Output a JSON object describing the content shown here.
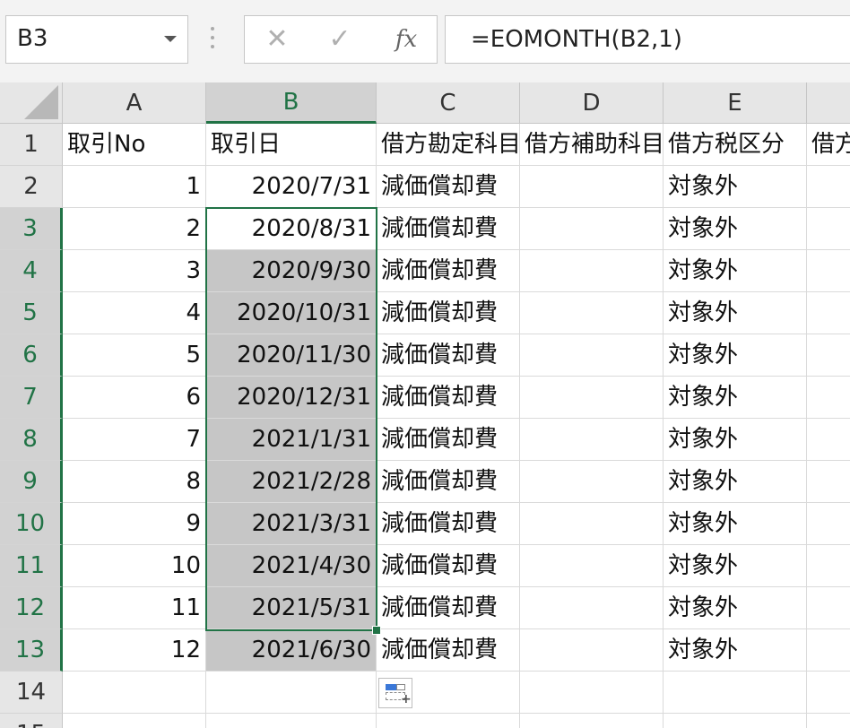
{
  "formula_bar": {
    "name_box": "B3",
    "cancel_icon": "✕",
    "enter_icon": "✓",
    "fx_label": "fx",
    "formula": "=EOMONTH(B2,1)"
  },
  "sheet": {
    "columns": [
      "A",
      "B",
      "C",
      "D",
      "E",
      ""
    ],
    "rows": [
      "1",
      "2",
      "3",
      "4",
      "5",
      "6",
      "7",
      "8",
      "9",
      "10",
      "11",
      "12",
      "13",
      "14",
      "15"
    ],
    "selected_column": "B",
    "selected_rows": [
      "3",
      "4",
      "5",
      "6",
      "7",
      "8",
      "9",
      "10",
      "11",
      "12",
      "13"
    ],
    "active_cell": "B3",
    "header_row": [
      "取引No",
      "取引日",
      "借方勘定科目",
      "借方補助科目",
      "借方税区分",
      "借方"
    ],
    "data_rows": [
      {
        "no": "1",
        "date": "2020/7/31",
        "account": "減価償却費",
        "sub": "",
        "tax": "対象外"
      },
      {
        "no": "2",
        "date": "2020/8/31",
        "account": "減価償却費",
        "sub": "",
        "tax": "対象外"
      },
      {
        "no": "3",
        "date": "2020/9/30",
        "account": "減価償却費",
        "sub": "",
        "tax": "対象外"
      },
      {
        "no": "4",
        "date": "2020/10/31",
        "account": "減価償却費",
        "sub": "",
        "tax": "対象外"
      },
      {
        "no": "5",
        "date": "2020/11/30",
        "account": "減価償却費",
        "sub": "",
        "tax": "対象外"
      },
      {
        "no": "6",
        "date": "2020/12/31",
        "account": "減価償却費",
        "sub": "",
        "tax": "対象外"
      },
      {
        "no": "7",
        "date": "2021/1/31",
        "account": "減価償却費",
        "sub": "",
        "tax": "対象外"
      },
      {
        "no": "8",
        "date": "2021/2/28",
        "account": "減価償却費",
        "sub": "",
        "tax": "対象外"
      },
      {
        "no": "9",
        "date": "2021/3/31",
        "account": "減価償却費",
        "sub": "",
        "tax": "対象外"
      },
      {
        "no": "10",
        "date": "2021/4/30",
        "account": "減価償却費",
        "sub": "",
        "tax": "対象外"
      },
      {
        "no": "11",
        "date": "2021/5/31",
        "account": "減価償却費",
        "sub": "",
        "tax": "対象外"
      },
      {
        "no": "12",
        "date": "2021/6/30",
        "account": "減価償却費",
        "sub": "",
        "tax": "対象外"
      }
    ]
  },
  "icons": {
    "name_box_dropdown": "chevron-down-icon",
    "quick_analysis": "auto-fill-options-icon"
  },
  "colors": {
    "selection_accent": "#217346",
    "selection_fill": "#c6c6c6",
    "header_bg": "#e6e6e6"
  }
}
